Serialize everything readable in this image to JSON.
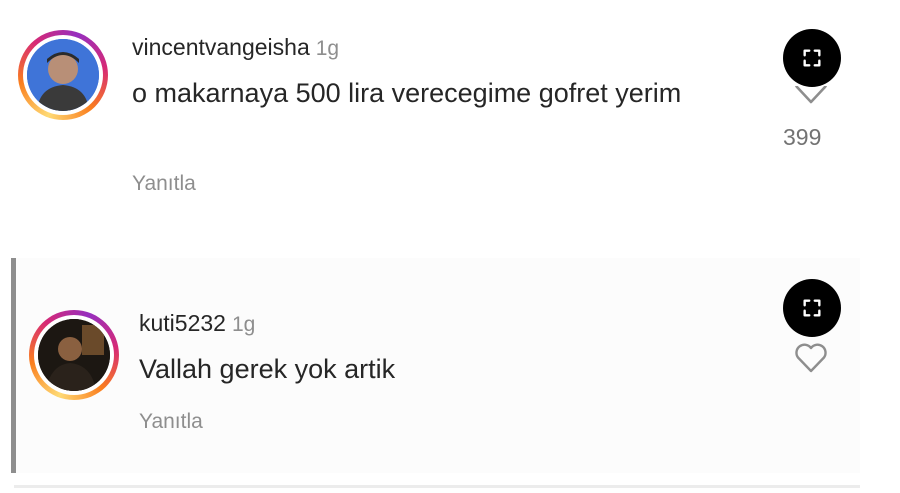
{
  "comments": [
    {
      "username": "vincentvangeisha",
      "time": "1g",
      "text": "o makarnaya 500 lira verecegime gofret yerim",
      "reply_label": "Yanıtla",
      "like_count": "399",
      "avatar_icon": "user-avatar",
      "expand_icon": "expand-icon",
      "like_icon": "heart-outline-icon"
    },
    {
      "username": "kuti5232",
      "time": "1g",
      "text": "Vallah gerek yok artik",
      "reply_label": "Yanıtla",
      "avatar_icon": "user-avatar",
      "expand_icon": "expand-icon",
      "like_icon": "heart-outline-icon"
    }
  ],
  "colors": {
    "text": "#262626",
    "secondary": "#8e8e8e",
    "expand_button": "#000000",
    "reply_bar": "#8e8e8e"
  }
}
